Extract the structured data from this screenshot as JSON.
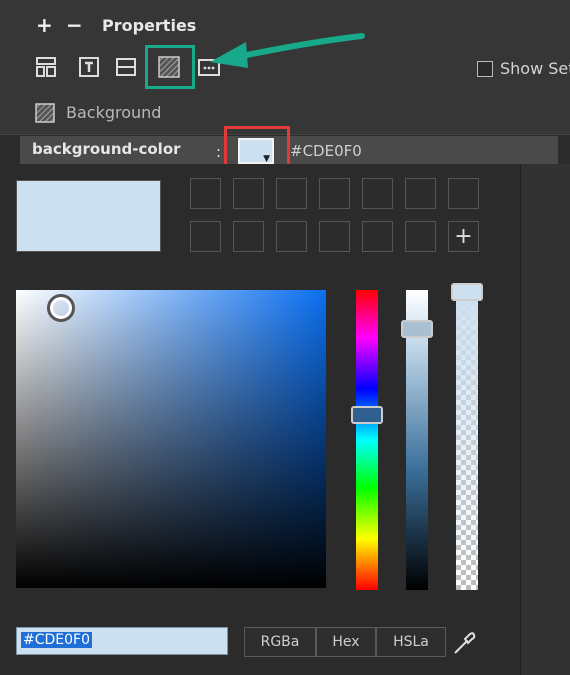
{
  "panel": {
    "title": "Properties",
    "add_label": "+",
    "remove_label": "−"
  },
  "toolbar": {
    "show_label": "Show Set"
  },
  "section": {
    "background_label": "Background"
  },
  "property": {
    "name": "background-color",
    "colon": ":",
    "value": "#CDE0F0"
  },
  "picker": {
    "current_color": "#CDE0F0",
    "hex_input_value": "#CDE0F0",
    "formats": [
      "RGBa",
      "Hex",
      "HSLa"
    ],
    "add_swatch_label": "+"
  },
  "annotations": {
    "highlight_green": "#17a98a",
    "highlight_red": "#e03a3a"
  }
}
